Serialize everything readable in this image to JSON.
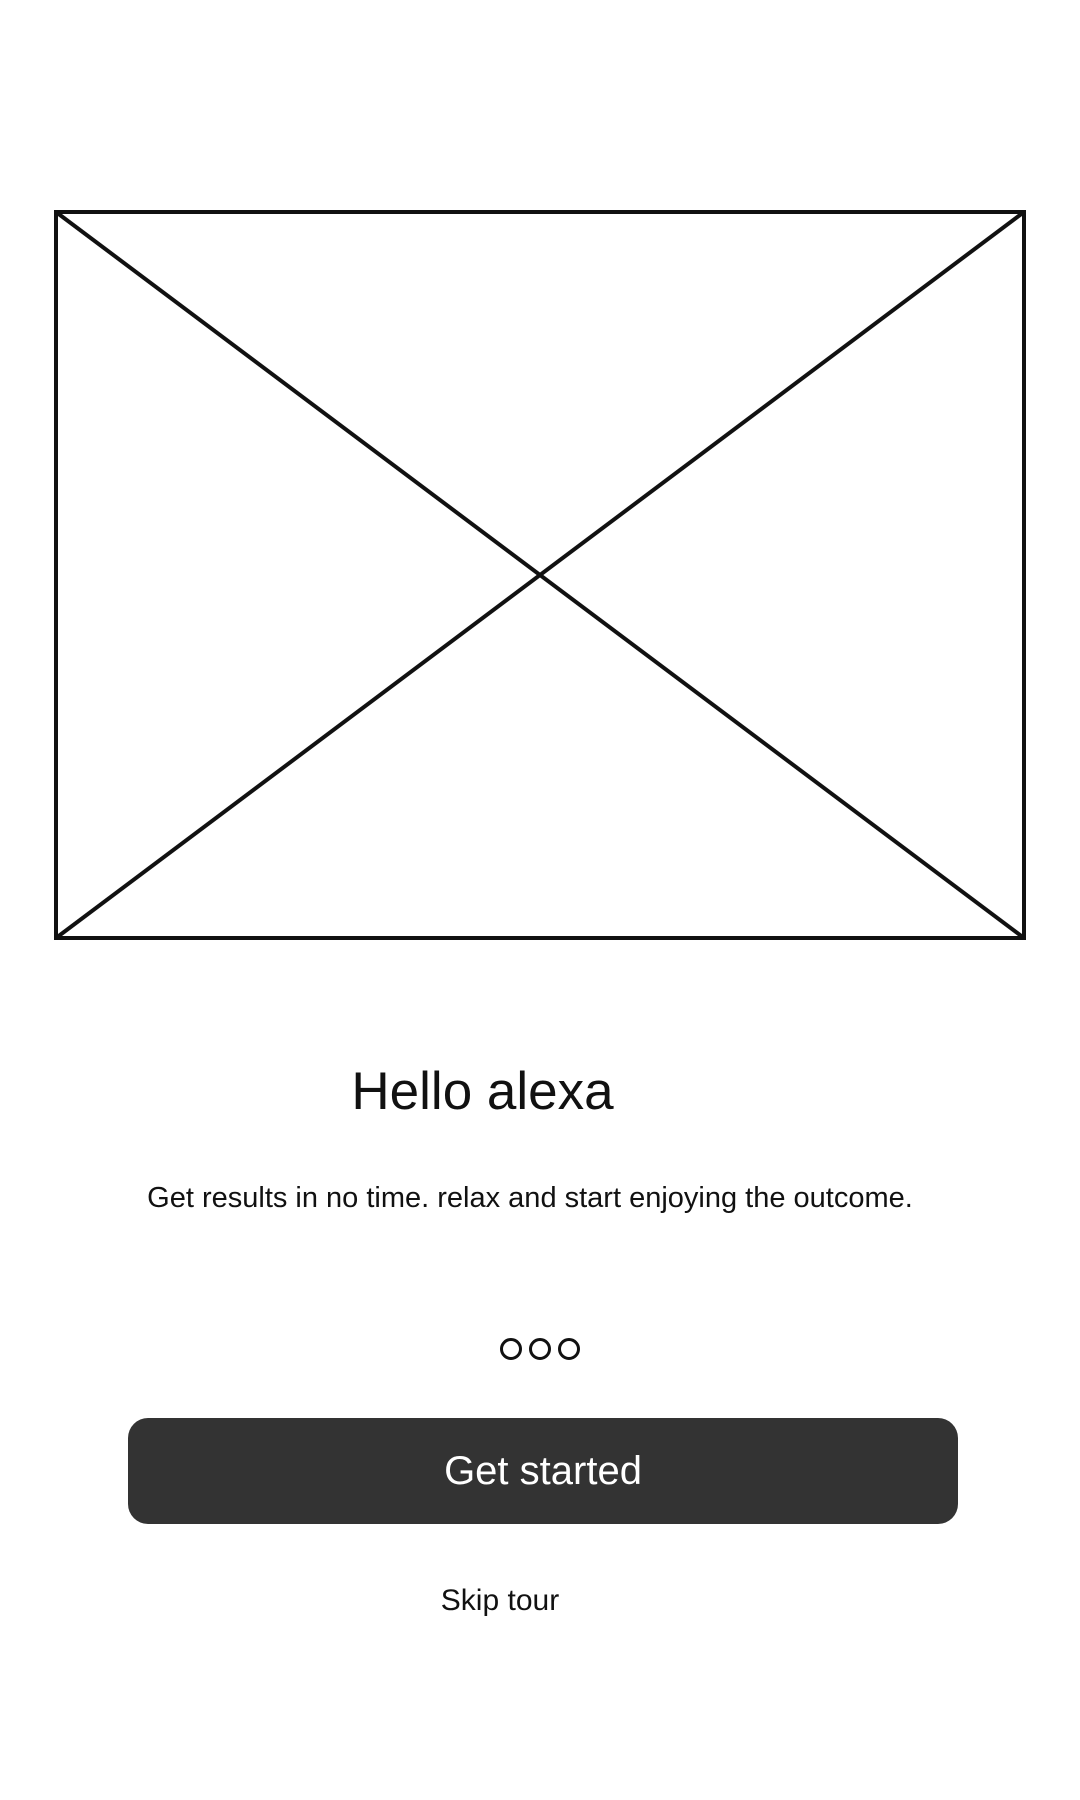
{
  "hero": {
    "icon": "image-placeholder-icon"
  },
  "title": "Hello alexa",
  "subtitle": "Get results in no time. relax and start enjoying the outcome.",
  "pager": {
    "total": 3,
    "icon": "pagination-dot-icon"
  },
  "primary_button": {
    "label": "Get started",
    "color": "#333333",
    "text_color": "#ffffff"
  },
  "skip_link": {
    "label": "Skip tour"
  }
}
